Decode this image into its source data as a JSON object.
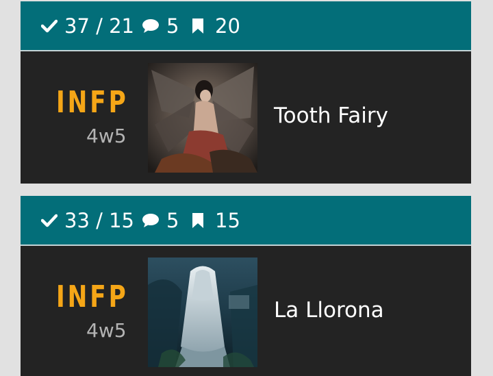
{
  "icons": {
    "votes": "check-icon",
    "comments": "speech-bubble-icon",
    "bookmarks": "bookmark-icon"
  },
  "colors": {
    "header_bg": "#036e79",
    "body_bg": "#232323",
    "mbti": "#f5a617",
    "enneagram": "#b4b4b4",
    "page_bg": "#e1e1e1"
  },
  "cards": [
    {
      "votes": "37 / 21",
      "comments": "5",
      "bookmarks": "20",
      "mbti": "INFP",
      "enneagram": "4w5",
      "name": "Tooth Fairy"
    },
    {
      "votes": "33 / 15",
      "comments": "5",
      "bookmarks": "15",
      "mbti": "INFP",
      "enneagram": "4w5",
      "name": "La Llorona"
    }
  ]
}
